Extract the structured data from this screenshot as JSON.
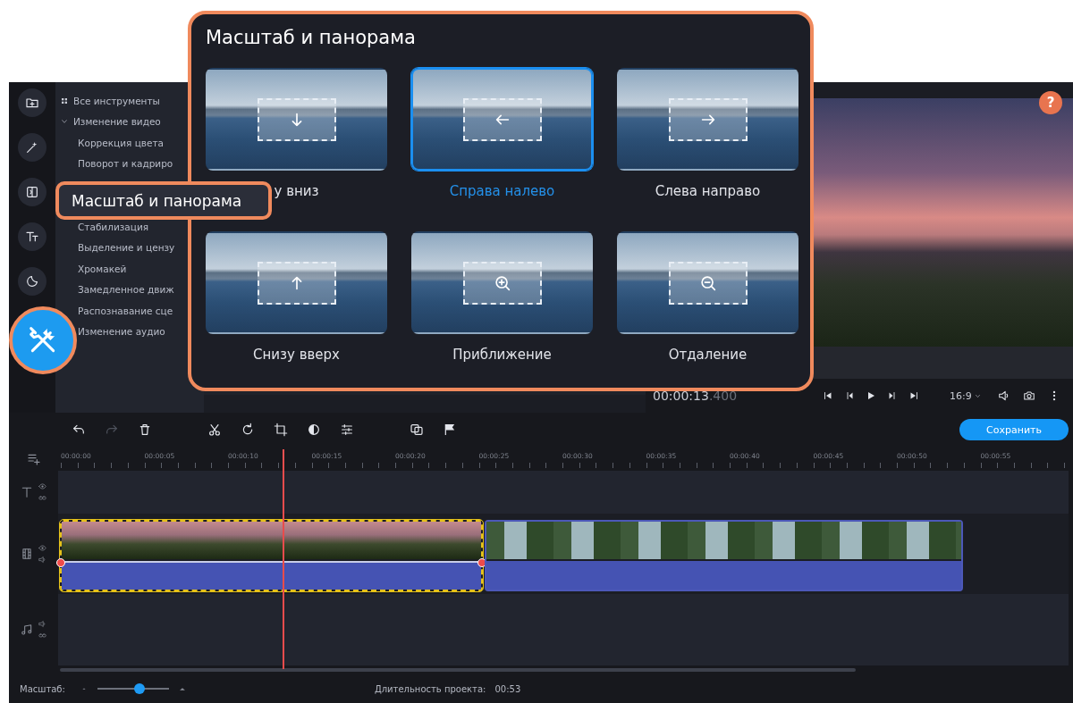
{
  "tools_list": [
    {
      "kind": "all",
      "label": "Все инструменты"
    },
    {
      "kind": "group",
      "label": "Изменение видео",
      "expanded": true,
      "children": [
        {
          "label": "Коррекция цвета"
        },
        {
          "label": "Поворот и кадриро"
        },
        {
          "label": "Стабилизация",
          "gap": true
        },
        {
          "label": "Выделение и цензу"
        },
        {
          "label": "Хромакей"
        },
        {
          "label": "Замедленное движ"
        },
        {
          "label": "Распознавание сце"
        },
        {
          "label": "Изменение аудио"
        }
      ]
    }
  ],
  "callout": {
    "label": "Масштаб и панорама"
  },
  "popup": {
    "title": "Масштаб и панорама",
    "effects": [
      {
        "kind": "down",
        "label": "у вниз",
        "selected": false
      },
      {
        "kind": "left",
        "label": "Справа налево",
        "selected": true
      },
      {
        "kind": "right",
        "label": "Слева направо",
        "selected": false
      },
      {
        "kind": "up",
        "label": "Снизу вверх",
        "selected": false
      },
      {
        "kind": "zoom-in",
        "label": "Приближение",
        "selected": false
      },
      {
        "kind": "zoom-out",
        "label": "Отдаление",
        "selected": false
      }
    ]
  },
  "preview": {
    "help": "?",
    "timecode": "00:00:13",
    "timecode_fraction": ".400",
    "aspect": "16:9"
  },
  "toolbar": [
    {
      "kind": "undo",
      "disabled": false
    },
    {
      "kind": "redo",
      "disabled": true
    },
    {
      "kind": "delete",
      "disabled": false
    },
    {
      "kind": "cut",
      "disabled": false
    },
    {
      "kind": "rotate",
      "disabled": false
    },
    {
      "kind": "crop",
      "disabled": false
    },
    {
      "kind": "color",
      "disabled": false
    },
    {
      "kind": "adjust",
      "disabled": false
    },
    {
      "kind": "overlay",
      "disabled": false
    },
    {
      "kind": "marker",
      "disabled": false
    }
  ],
  "save_button": "Сохранить",
  "ruler": [
    "00:00:00",
    "00:00:05",
    "00:00:10",
    "00:00:15",
    "00:00:20",
    "00:00:25",
    "00:00:30",
    "00:00:35",
    "00:00:40",
    "00:00:45",
    "00:00:50",
    "00:00:55"
  ],
  "tracks": [
    {
      "kind": "text"
    },
    {
      "kind": "video",
      "clips": [
        {
          "kind": "sunset",
          "selected": true
        },
        {
          "kind": "palms",
          "selected": false
        }
      ]
    },
    {
      "kind": "audio"
    }
  ],
  "status_bar": {
    "zoom_label": "Масштаб:",
    "zoom": {
      "level": 0.59
    },
    "duration_label": "Длительность проекта:",
    "duration": "00:53"
  }
}
